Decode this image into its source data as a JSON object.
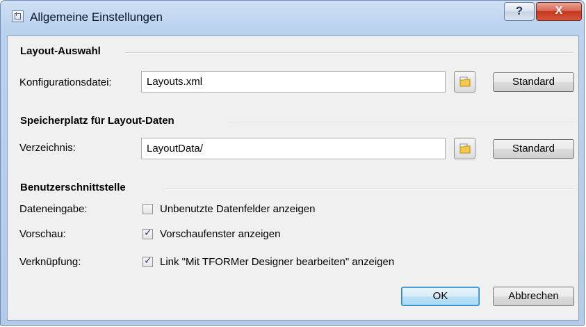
{
  "window": {
    "title": "Allgemeine Einstellungen",
    "help_label": "?",
    "close_label": "X"
  },
  "layout_section": {
    "title": "Layout-Auswahl",
    "config_label": "Konfigurationsdatei:",
    "config_value": "Layouts.xml",
    "standard_label": "Standard"
  },
  "storage_section": {
    "title": "Speicherplatz für Layout-Daten",
    "dir_label": "Verzeichnis:",
    "dir_value": "LayoutData/",
    "standard_label": "Standard"
  },
  "ui_section": {
    "title": "Benutzerschnittstelle",
    "rows": [
      {
        "label": "Dateneingabe:",
        "option": "Unbenutzte Datenfelder anzeigen",
        "checked": false
      },
      {
        "label": "Vorschau:",
        "option": "Vorschaufenster anzeigen",
        "checked": true
      },
      {
        "label": "Verknüpfung:",
        "option": "Link \"Mit TFORMer Designer bearbeiten\" anzeigen",
        "checked": true
      }
    ]
  },
  "footer": {
    "ok_label": "OK",
    "cancel_label": "Abbrechen"
  }
}
